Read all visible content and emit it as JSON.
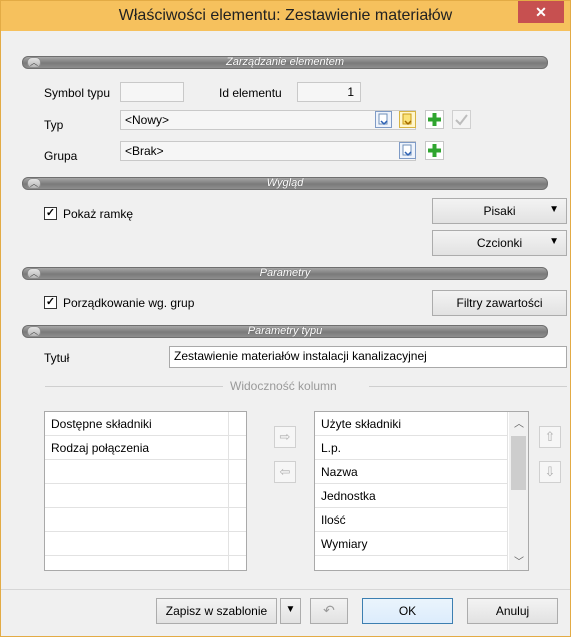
{
  "window": {
    "title": "Właściwości elementu: Zestawienie materiałów",
    "close_glyph": "✕"
  },
  "sections": {
    "zarzadzanie": "Zarządzanie elementem",
    "wyglad": "Wygląd",
    "parametry": "Parametry",
    "parametry_typu": "Parametry typu"
  },
  "element": {
    "symbol_label": "Symbol typu",
    "symbol_value": "",
    "id_label": "Id elementu",
    "id_value": "1",
    "typ_label": "Typ",
    "typ_value": "<Nowy>",
    "grupa_label": "Grupa",
    "grupa_value": "<Brak>"
  },
  "wyglad": {
    "show_frame_label": "Pokaż ramkę",
    "show_frame_checked": true,
    "pisaki_label": "Pisaki",
    "czcionki_label": "Czcionki"
  },
  "parametry": {
    "group_order_label": "Porządkowanie wg. grup",
    "group_order_checked": true,
    "filters_label": "Filtry zawartości"
  },
  "parametry_typu": {
    "title_label": "Tytuł",
    "title_value": "Zestawienie materiałów instalacji kanalizacyjnej",
    "columns_header": "Widoczność kolumn",
    "available_header": "Dostępne składniki",
    "available_items": [
      "Rodzaj połączenia"
    ],
    "used_header": "Użyte składniki",
    "used_items": [
      "L.p.",
      "Nazwa",
      "Jednostka",
      "Ilość",
      "Wymiary"
    ]
  },
  "footer": {
    "save_template_label": "Zapisz w szablonie",
    "ok_label": "OK",
    "cancel_label": "Anuluj"
  },
  "icons": {
    "move_right": "right-arrow-icon",
    "move_left": "left-arrow-icon",
    "move_up": "up-arrow-icon",
    "move_down": "down-arrow-icon",
    "undo": "undo-icon",
    "add": "green-plus-icon",
    "accept": "checkmark-icon"
  },
  "colors": {
    "titlebar": "#f6c15d",
    "close": "#c75050",
    "section": "#8e8e8e",
    "plus": "#2fa52f"
  }
}
